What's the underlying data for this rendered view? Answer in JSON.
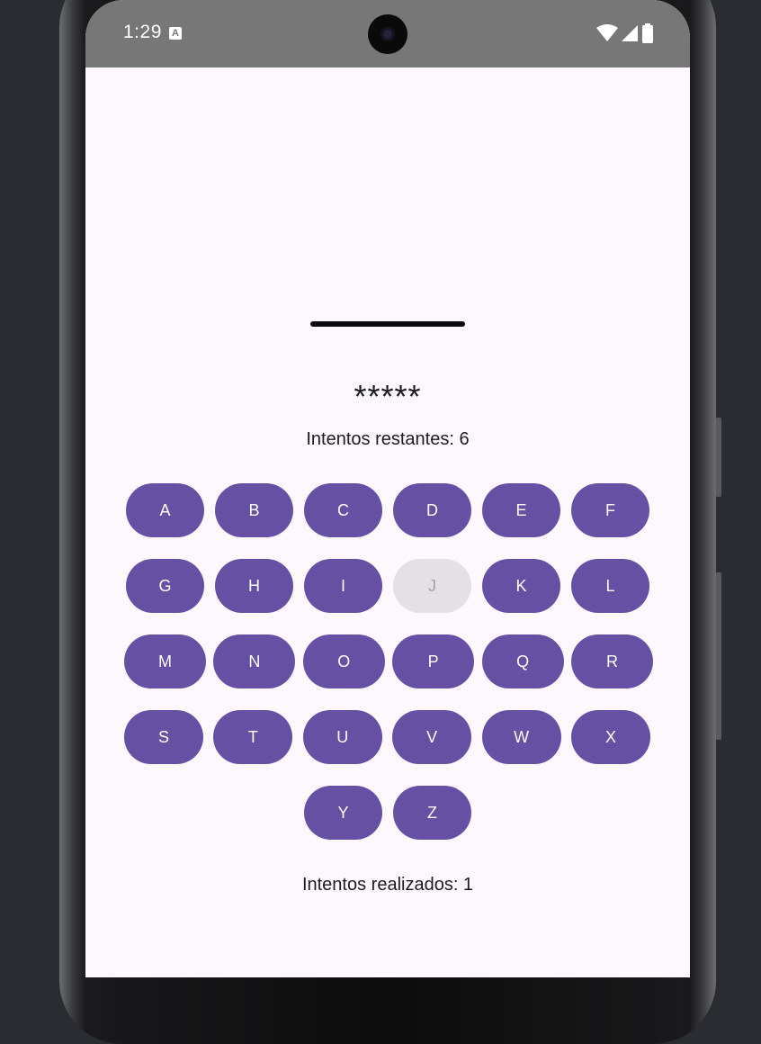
{
  "status_bar": {
    "time": "1:29",
    "notification_icon": "A"
  },
  "game": {
    "hidden_word": "*****",
    "remaining_label": "Intentos restantes: 6",
    "performed_label": "Intentos realizados: 1"
  },
  "keyboard": {
    "keys": [
      {
        "letter": "A",
        "enabled": true
      },
      {
        "letter": "B",
        "enabled": true
      },
      {
        "letter": "C",
        "enabled": true
      },
      {
        "letter": "D",
        "enabled": true
      },
      {
        "letter": "E",
        "enabled": true
      },
      {
        "letter": "F",
        "enabled": true
      },
      {
        "letter": "G",
        "enabled": true
      },
      {
        "letter": "H",
        "enabled": true
      },
      {
        "letter": "I",
        "enabled": true
      },
      {
        "letter": "J",
        "enabled": false
      },
      {
        "letter": "K",
        "enabled": true
      },
      {
        "letter": "L",
        "enabled": true
      },
      {
        "letter": "M",
        "enabled": true
      },
      {
        "letter": "N",
        "enabled": true
      },
      {
        "letter": "O",
        "enabled": true
      },
      {
        "letter": "P",
        "enabled": true
      },
      {
        "letter": "Q",
        "enabled": true
      },
      {
        "letter": "R",
        "enabled": true
      },
      {
        "letter": "S",
        "enabled": true
      },
      {
        "letter": "T",
        "enabled": true
      },
      {
        "letter": "U",
        "enabled": true
      },
      {
        "letter": "V",
        "enabled": true
      },
      {
        "letter": "W",
        "enabled": true
      },
      {
        "letter": "X",
        "enabled": true
      },
      {
        "letter": "Y",
        "enabled": true
      },
      {
        "letter": "Z",
        "enabled": true
      }
    ]
  },
  "colors": {
    "key_bg": "#6650a4",
    "key_disabled_bg": "#e3e1e5",
    "screen_bg": "#fdf8fd",
    "status_bar_bg": "#777777"
  }
}
